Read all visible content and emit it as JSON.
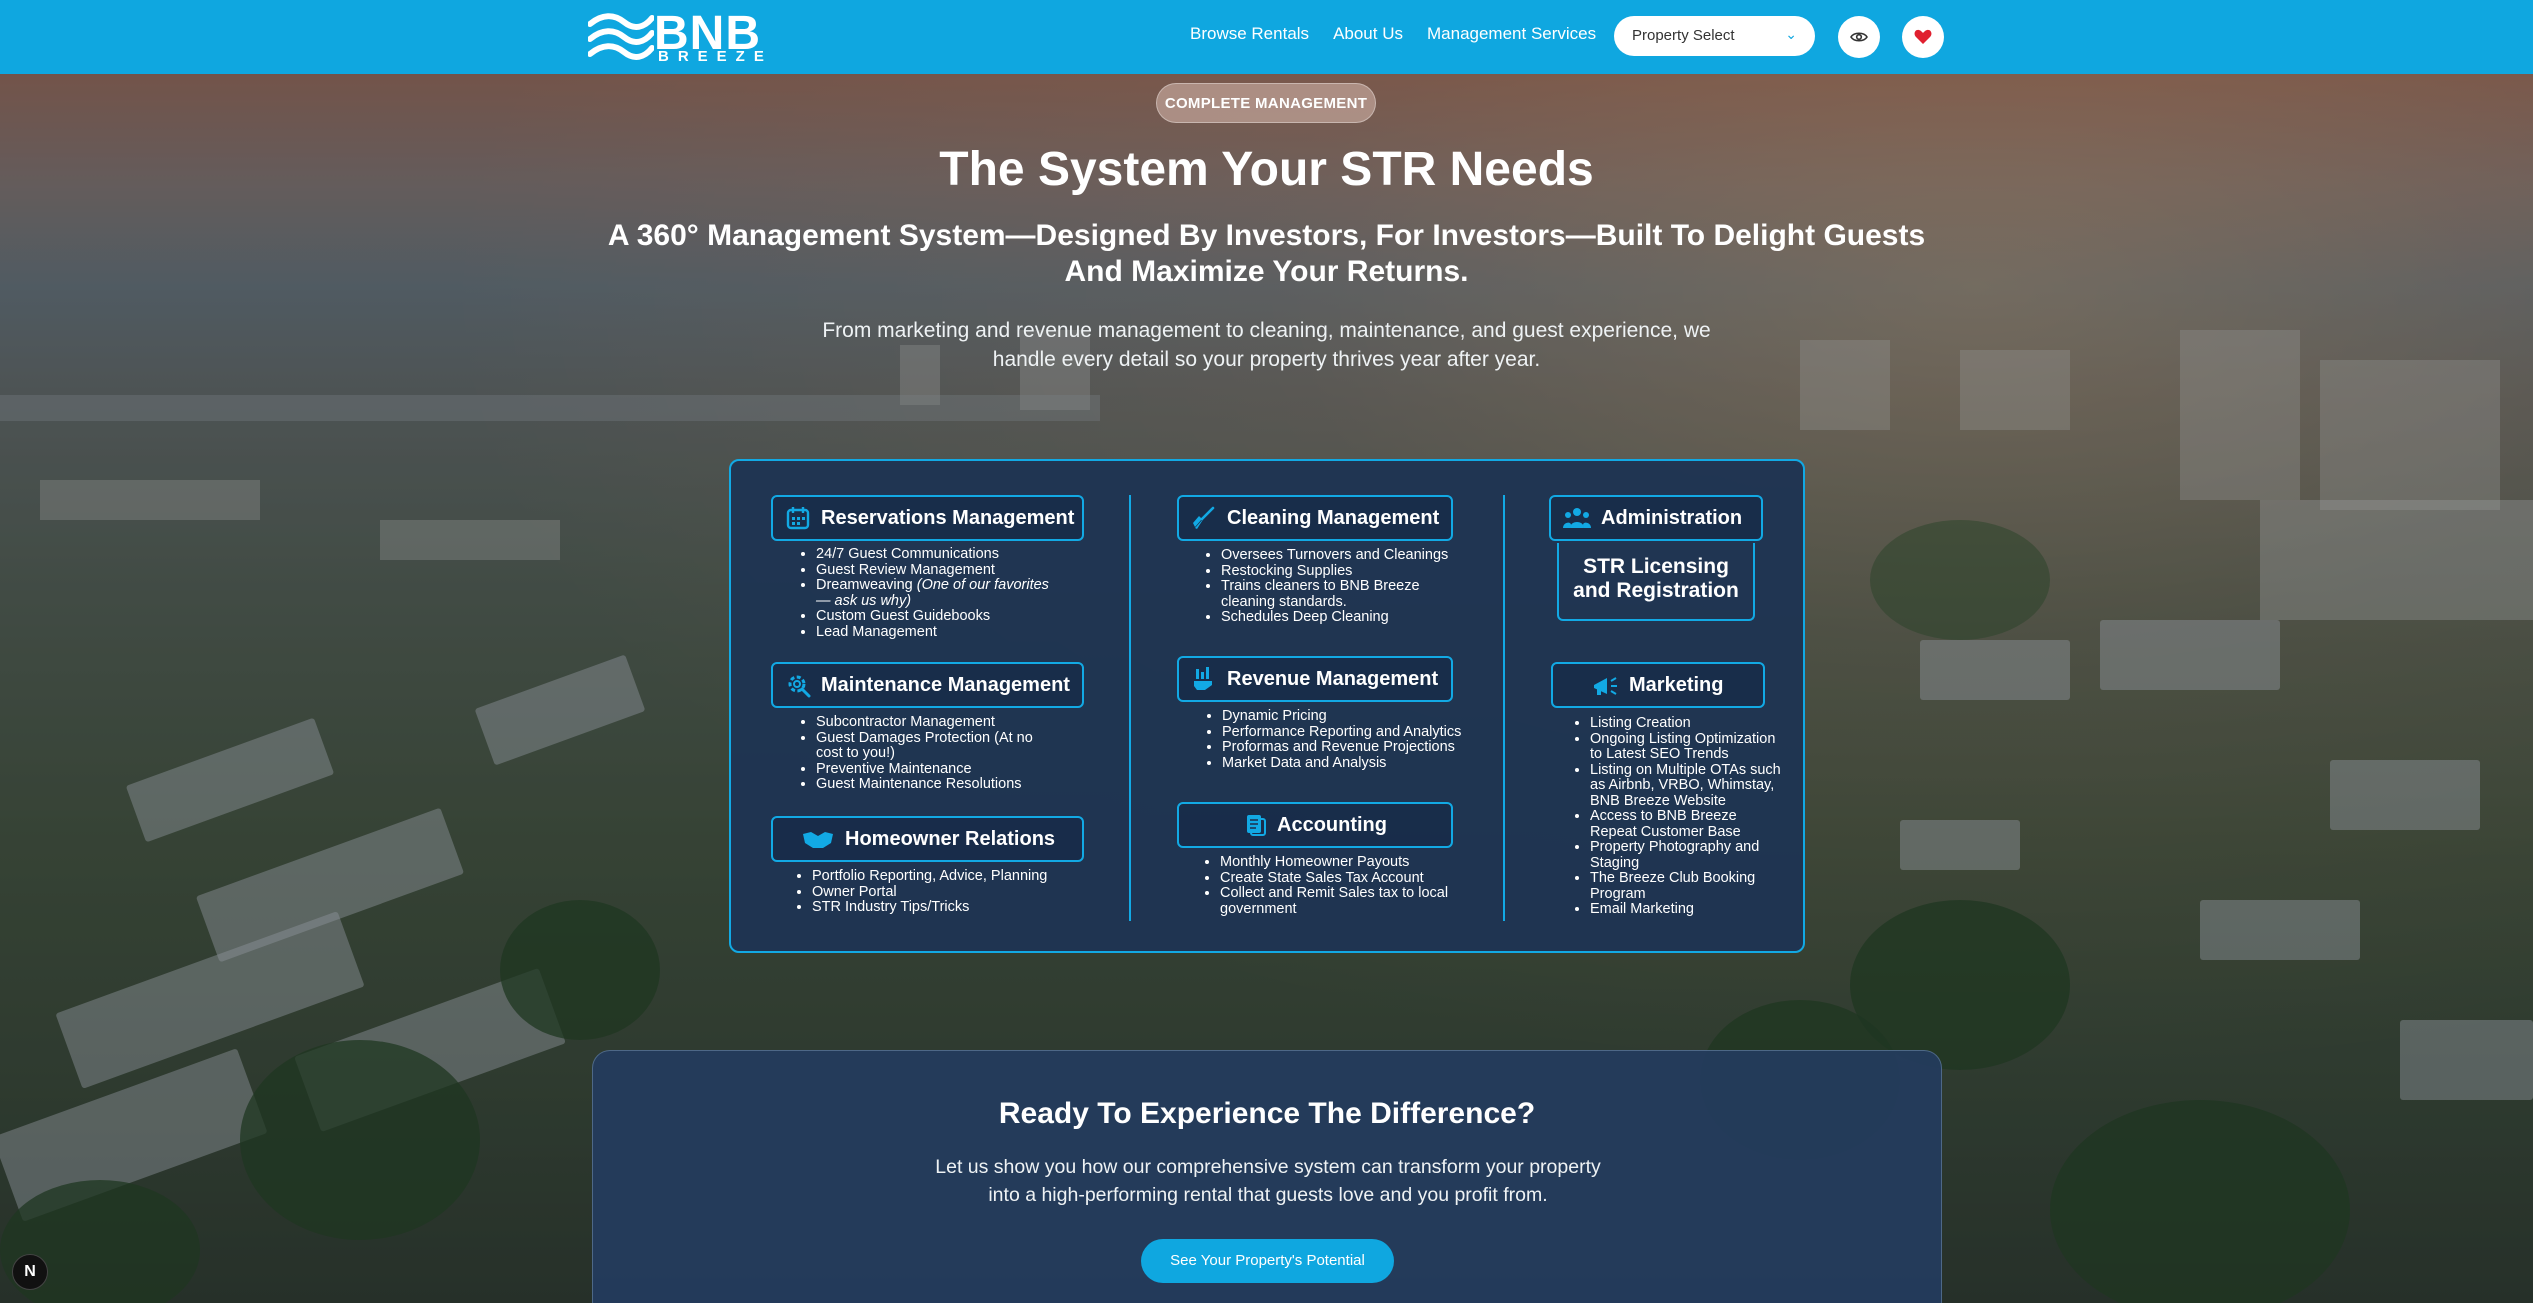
{
  "nav": {
    "logo_main": "BNB",
    "logo_sub": "BREEZE",
    "links": [
      "Browse Rentals",
      "About Us",
      "Management Services"
    ],
    "property_select": "Property Select"
  },
  "hero": {
    "badge": "COMPLETE MANAGEMENT",
    "title": "The System Your STR Needs",
    "subtitle_line1": "A 360° Management System—Designed By Investors, For Investors—Built To Delight Guests",
    "subtitle_line2": "And Maximize Your Returns.",
    "lead_line1": "From marketing and revenue management to cleaning, maintenance, and guest experience, we",
    "lead_line2": "handle every detail so your property thrives year after year."
  },
  "services": {
    "reservations": {
      "title": "Reservations Management",
      "items": [
        "24/7 Guest Communications",
        "Guest Review Management",
        "Dreamweaving",
        "Custom Guest Guidebooks",
        "Lead Management"
      ],
      "dreamweaving_note_1": "(One of our favorites",
      "dreamweaving_note_2": "— ask us why)"
    },
    "maintenance": {
      "title": "Maintenance Management",
      "items": [
        "Subcontractor Management",
        "Guest Damages Protection (At no",
        "cost to you!)",
        "Preventive Maintenance",
        "Guest Maintenance Resolutions"
      ]
    },
    "homeowner": {
      "title": "Homeowner Relations",
      "items": [
        "Portfolio Reporting, Advice, Planning",
        "Owner Portal",
        "STR Industry Tips/Tricks"
      ]
    },
    "cleaning": {
      "title": "Cleaning Management",
      "items": [
        "Oversees Turnovers and Cleanings",
        "Restocking Supplies",
        "Trains cleaners to BNB Breeze",
        "cleaning standards.",
        "Schedules Deep Cleaning"
      ]
    },
    "revenue": {
      "title": "Revenue Management",
      "items": [
        "Dynamic Pricing",
        "Performance Reporting and Analytics",
        "Proformas and Revenue Projections",
        "Market Data and Analysis"
      ]
    },
    "accounting": {
      "title": "Accounting",
      "items": [
        "Monthly Homeowner Payouts",
        "Create State Sales Tax Account",
        "Collect and Remit Sales tax to local",
        "government"
      ]
    },
    "administration": {
      "title": "Administration",
      "licensing_line1": "STR Licensing",
      "licensing_line2": "and Registration"
    },
    "marketing": {
      "title": "Marketing",
      "items": [
        "Listing Creation",
        "Ongoing Listing Optimization",
        "to Latest SEO Trends",
        "Listing on Multiple OTAs such",
        "as Airbnb, VRBO, Whimstay,",
        "BNB Breeze Website",
        "Access to BNB Breeze",
        "Repeat Customer Base",
        "Property Photography and",
        "Staging",
        "The Breeze Club Booking",
        "Program",
        "Email Marketing"
      ]
    }
  },
  "cta": {
    "title": "Ready To Experience The Difference?",
    "text_line1": "Let us show you how our comprehensive system can transform your property",
    "text_line2": "into a high-performing rental that guests love and you profit from.",
    "button": "See Your Property's Potential"
  },
  "badge_letter": "N",
  "colors": {
    "brand": "#0fa7e0",
    "panel": "#1e3452",
    "heart": "#e0202f"
  },
  "icons": [
    "eye-icon",
    "heart-icon",
    "chevron-down-icon",
    "calendar-icon",
    "gear-icon",
    "handshake-icon",
    "broom-icon",
    "chart-hand-icon",
    "document-icon",
    "people-icon",
    "megaphone-icon"
  ]
}
